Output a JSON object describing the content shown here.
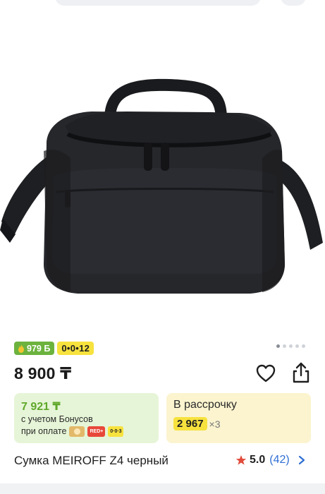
{
  "topbar": {
    "search_icon": "search-icon",
    "actions_icon": "menu-icon"
  },
  "product": {
    "image_alt": "Сумка MEIROFF Z4 черный",
    "price": "8 900 ₸",
    "name": "Сумка MEIROFF Z4 черный",
    "rating_value": "5.0",
    "rating_count": "(42)"
  },
  "badges": {
    "bonus": "979 Б",
    "installment": "0•0•12"
  },
  "gallery": {
    "total_images": 5,
    "active_index": 0
  },
  "bonus_card": {
    "amount": "7 921 ₸",
    "line1": "с учетом Бонусов",
    "line2": "при оплате",
    "chips": [
      "coin-icon",
      "RED+",
      "0·0·3"
    ]
  },
  "installment_card": {
    "title": "В рассрочку",
    "monthly": "2 967",
    "times": "×3"
  },
  "colors": {
    "accent_green": "#6cb33e",
    "accent_yellow": "#f7e23e",
    "link_blue": "#2f6fd4",
    "star_red": "#e14b3b"
  }
}
